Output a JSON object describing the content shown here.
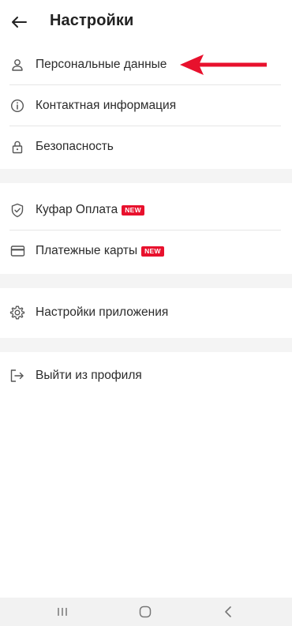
{
  "header": {
    "title": "Настройки",
    "back_icon": "arrow-left-icon"
  },
  "sections": [
    {
      "items": [
        {
          "label": "Персональные данные",
          "icon": "user-icon"
        },
        {
          "label": "Контактная информация",
          "icon": "info-icon"
        },
        {
          "label": "Безопасность",
          "icon": "lock-icon"
        }
      ]
    },
    {
      "items": [
        {
          "label": "Куфар Оплата",
          "icon": "shield-check-icon",
          "badge": "NEW"
        },
        {
          "label": "Платежные карты",
          "icon": "card-icon",
          "badge": "NEW"
        }
      ]
    },
    {
      "items": [
        {
          "label": "Настройки приложения",
          "icon": "gear-icon"
        }
      ]
    },
    {
      "items": [
        {
          "label": "Выйти из профиля",
          "icon": "logout-icon"
        }
      ]
    }
  ],
  "annotation": {
    "icon": "red-arrow-icon",
    "color": "#e8112d"
  },
  "navbar": {
    "icons": [
      "recent-apps-icon",
      "home-icon",
      "back-nav-icon"
    ]
  },
  "colors": {
    "badge": "#e8112d",
    "separator": "#f4f4f4",
    "text": "#222222"
  }
}
